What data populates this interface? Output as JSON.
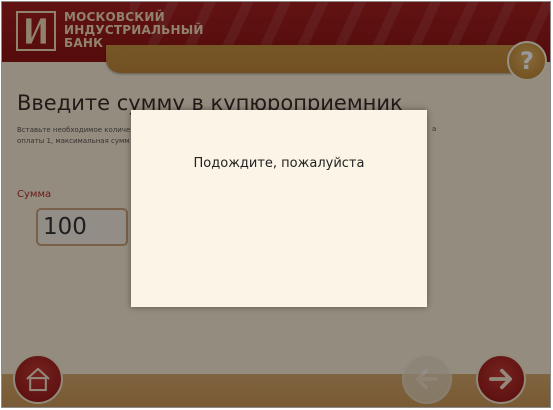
{
  "header": {
    "bank_name_lines": [
      "МОСКОВСКИЙ",
      "ИНДУСТРИАЛЬНЫЙ",
      "БАНК"
    ],
    "help_label": "?"
  },
  "main": {
    "title": "Введите сумму в купюроприемник",
    "instruction_lines": [
      "Вставьте необходимое количе",
      "оплаты 1, максимальная сумм"
    ],
    "instruction_tail": "а",
    "amount_label": "Сумма",
    "amount_value": "100"
  },
  "modal": {
    "message": "Подождите, пожалуйста"
  },
  "footer": {
    "home_icon": "home-icon",
    "back_icon": "arrow-left-icon",
    "next_icon": "arrow-right-icon"
  },
  "colors": {
    "brand_red": "#9c1e1b",
    "accent_gold": "#c58b3a",
    "background": "#f6ead4"
  }
}
